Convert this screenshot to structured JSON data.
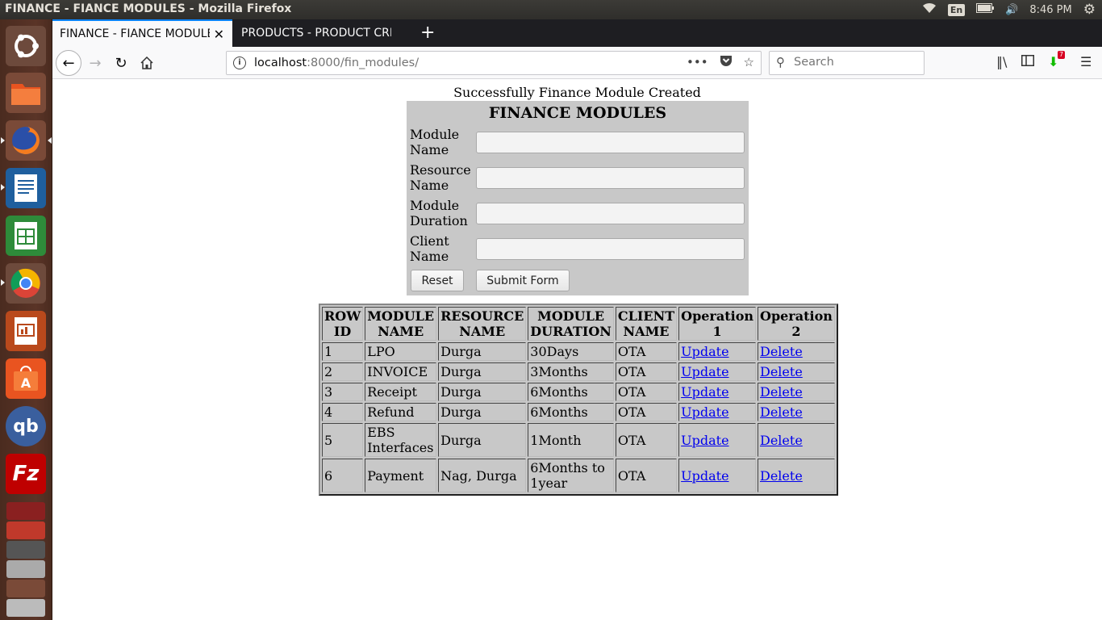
{
  "system": {
    "window_title": "FINANCE - FIANCE MODULES - Mozilla Firefox",
    "keyboard_layout": "En",
    "clock": "8:46 PM"
  },
  "launcher": {
    "items": [
      {
        "name": "ubuntu-dash-icon"
      },
      {
        "name": "files-icon"
      },
      {
        "name": "firefox-icon"
      },
      {
        "name": "libreoffice-writer-icon"
      },
      {
        "name": "libreoffice-calc-icon"
      },
      {
        "name": "chrome-icon"
      },
      {
        "name": "libreoffice-impress-icon"
      },
      {
        "name": "software-center-icon"
      },
      {
        "name": "qbittorrent-icon"
      },
      {
        "name": "filezilla-icon"
      }
    ]
  },
  "browser": {
    "tabs": [
      {
        "label": "FINANCE - FIANCE MODULE",
        "active": true
      },
      {
        "label": "PRODUCTS - PRODUCT CRE",
        "active": false
      }
    ],
    "url_host": "localhost",
    "url_rest": ":8000/fin_modules/",
    "search_placeholder": "Search",
    "download_badge": "7"
  },
  "page": {
    "message": "Successfully Finance Module Created",
    "form": {
      "title": "FINANCE MODULES",
      "fields": [
        {
          "label_1": "Module",
          "label_2": "Name",
          "value": ""
        },
        {
          "label_1": "Resource",
          "label_2": "Name",
          "value": ""
        },
        {
          "label_1": "Module",
          "label_2": "Duration",
          "value": ""
        },
        {
          "label_1": "Client",
          "label_2": "Name",
          "value": ""
        }
      ],
      "reset_label": "Reset",
      "submit_label": "Submit Form"
    },
    "table": {
      "headers": [
        [
          "ROW",
          "ID"
        ],
        [
          "MODULE",
          "NAME"
        ],
        [
          "RESOURCE",
          "NAME"
        ],
        [
          "MODULE",
          "DURATION"
        ],
        [
          "CLIENT",
          "NAME"
        ],
        [
          "Operation",
          "1"
        ],
        [
          "Operation",
          "2"
        ]
      ],
      "rows": [
        {
          "id": "1",
          "module": [
            "LPO"
          ],
          "resource": "Durga",
          "duration": [
            "30Days"
          ],
          "client": "OTA",
          "op1": "Update",
          "op2": "Delete"
        },
        {
          "id": "2",
          "module": [
            "INVOICE"
          ],
          "resource": "Durga",
          "duration": [
            "3Months"
          ],
          "client": "OTA",
          "op1": "Update",
          "op2": "Delete"
        },
        {
          "id": "3",
          "module": [
            "Receipt"
          ],
          "resource": "Durga",
          "duration": [
            "6Months"
          ],
          "client": "OTA",
          "op1": "Update",
          "op2": "Delete"
        },
        {
          "id": "4",
          "module": [
            "Refund"
          ],
          "resource": "Durga",
          "duration": [
            "6Months"
          ],
          "client": "OTA",
          "op1": "Update",
          "op2": "Delete"
        },
        {
          "id": "5",
          "module": [
            "EBS",
            "Interfaces"
          ],
          "resource": "Durga",
          "duration": [
            "1Month"
          ],
          "client": "OTA",
          "op1": "Update",
          "op2": "Delete"
        },
        {
          "id": "6",
          "module": [
            "Payment"
          ],
          "resource": "Nag, Durga",
          "duration": [
            "6Months to",
            "1year"
          ],
          "client": "OTA",
          "op1": "Update",
          "op2": "Delete"
        }
      ]
    }
  }
}
